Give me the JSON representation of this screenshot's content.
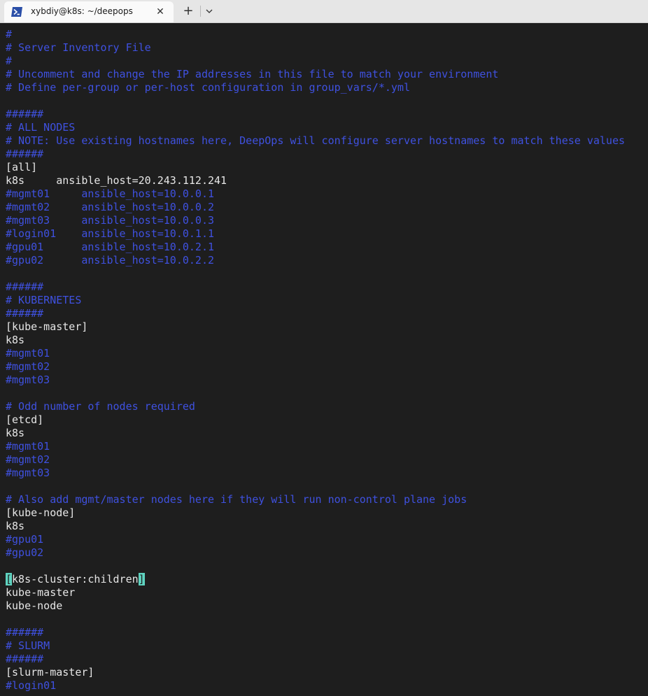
{
  "tab": {
    "title": "xybdiy@k8s: ~/deepops",
    "icon": "powershell-icon",
    "close_label": "✕",
    "new_label": "+",
    "dropdown_icon": "chevron-down-icon"
  },
  "colors": {
    "comment": "#3f51e0",
    "text": "#e6e6e6",
    "background": "#1e1e1e",
    "cursor": "#5fd3c0"
  },
  "terminal": {
    "lines": [
      {
        "text": "#",
        "type": "comment"
      },
      {
        "text": "# Server Inventory File",
        "type": "comment"
      },
      {
        "text": "#",
        "type": "comment"
      },
      {
        "text": "# Uncomment and change the IP addresses in this file to match your environment",
        "type": "comment"
      },
      {
        "text": "# Define per-group or per-host configuration in group_vars/*.yml",
        "type": "comment"
      },
      {
        "text": "",
        "type": "text"
      },
      {
        "text": "######",
        "type": "comment"
      },
      {
        "text": "# ALL NODES",
        "type": "comment"
      },
      {
        "text": "# NOTE: Use existing hostnames here, DeepOps will configure server hostnames to match these values",
        "type": "comment"
      },
      {
        "text": "######",
        "type": "comment"
      },
      {
        "text": "[all]",
        "type": "text"
      },
      {
        "text": "k8s     ansible_host=20.243.112.241",
        "type": "text"
      },
      {
        "text": "#mgmt01     ansible_host=10.0.0.1",
        "type": "comment"
      },
      {
        "text": "#mgmt02     ansible_host=10.0.0.2",
        "type": "comment"
      },
      {
        "text": "#mgmt03     ansible_host=10.0.0.3",
        "type": "comment"
      },
      {
        "text": "#login01    ansible_host=10.0.1.1",
        "type": "comment"
      },
      {
        "text": "#gpu01      ansible_host=10.0.2.1",
        "type": "comment"
      },
      {
        "text": "#gpu02      ansible_host=10.0.2.2",
        "type": "comment"
      },
      {
        "text": "",
        "type": "text"
      },
      {
        "text": "######",
        "type": "comment"
      },
      {
        "text": "# KUBERNETES",
        "type": "comment"
      },
      {
        "text": "######",
        "type": "comment"
      },
      {
        "text": "[kube-master]",
        "type": "text"
      },
      {
        "text": "k8s",
        "type": "text"
      },
      {
        "text": "#mgmt01",
        "type": "comment"
      },
      {
        "text": "#mgmt02",
        "type": "comment"
      },
      {
        "text": "#mgmt03",
        "type": "comment"
      },
      {
        "text": "",
        "type": "text"
      },
      {
        "text": "# Odd number of nodes required",
        "type": "comment"
      },
      {
        "text": "[etcd]",
        "type": "text"
      },
      {
        "text": "k8s",
        "type": "text"
      },
      {
        "text": "#mgmt01",
        "type": "comment"
      },
      {
        "text": "#mgmt02",
        "type": "comment"
      },
      {
        "text": "#mgmt03",
        "type": "comment"
      },
      {
        "text": "",
        "type": "text"
      },
      {
        "text": "# Also add mgmt/master nodes here if they will run non-control plane jobs",
        "type": "comment"
      },
      {
        "text": "[kube-node]",
        "type": "text"
      },
      {
        "text": "k8s",
        "type": "text"
      },
      {
        "text": "#gpu01",
        "type": "comment"
      },
      {
        "text": "#gpu02",
        "type": "comment"
      },
      {
        "text": "",
        "type": "text"
      },
      {
        "text": "[k8s-cluster:children]",
        "type": "cursor"
      },
      {
        "text": "kube-master",
        "type": "text"
      },
      {
        "text": "kube-node",
        "type": "text"
      },
      {
        "text": "",
        "type": "text"
      },
      {
        "text": "######",
        "type": "comment"
      },
      {
        "text": "# SLURM",
        "type": "comment"
      },
      {
        "text": "######",
        "type": "comment"
      },
      {
        "text": "[slurm-master]",
        "type": "text"
      },
      {
        "text": "#login01",
        "type": "comment"
      }
    ]
  }
}
